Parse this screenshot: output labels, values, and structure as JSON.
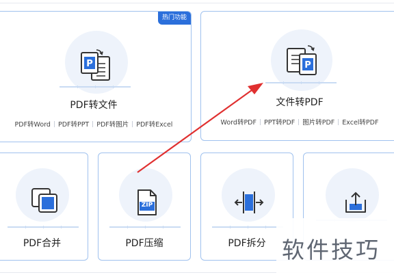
{
  "badge": "热门功能",
  "pdf_to_file": {
    "title": "PDF转文件",
    "options": [
      "PDF转Word",
      "PDF转PPT",
      "PDF转图片",
      "PDF转Excel"
    ]
  },
  "file_to_pdf": {
    "title": "文件转PDF",
    "options": [
      "Word转PDF",
      "PPT转PDF",
      "图片转PDF",
      "Excel转PDF"
    ]
  },
  "tools": [
    {
      "title": "PDF合并",
      "icon": "merge-icon"
    },
    {
      "title": "PDF压缩",
      "icon": "zip-file-icon",
      "icon_text": "ZIP"
    },
    {
      "title": "PDF拆分",
      "icon": "split-icon"
    },
    {
      "title": "",
      "icon": "upload-icon"
    }
  ],
  "watermark": "软件技巧",
  "colors": {
    "accent": "#2b6fdb",
    "arrow": "#e03030",
    "border": "#9fc1ee"
  }
}
